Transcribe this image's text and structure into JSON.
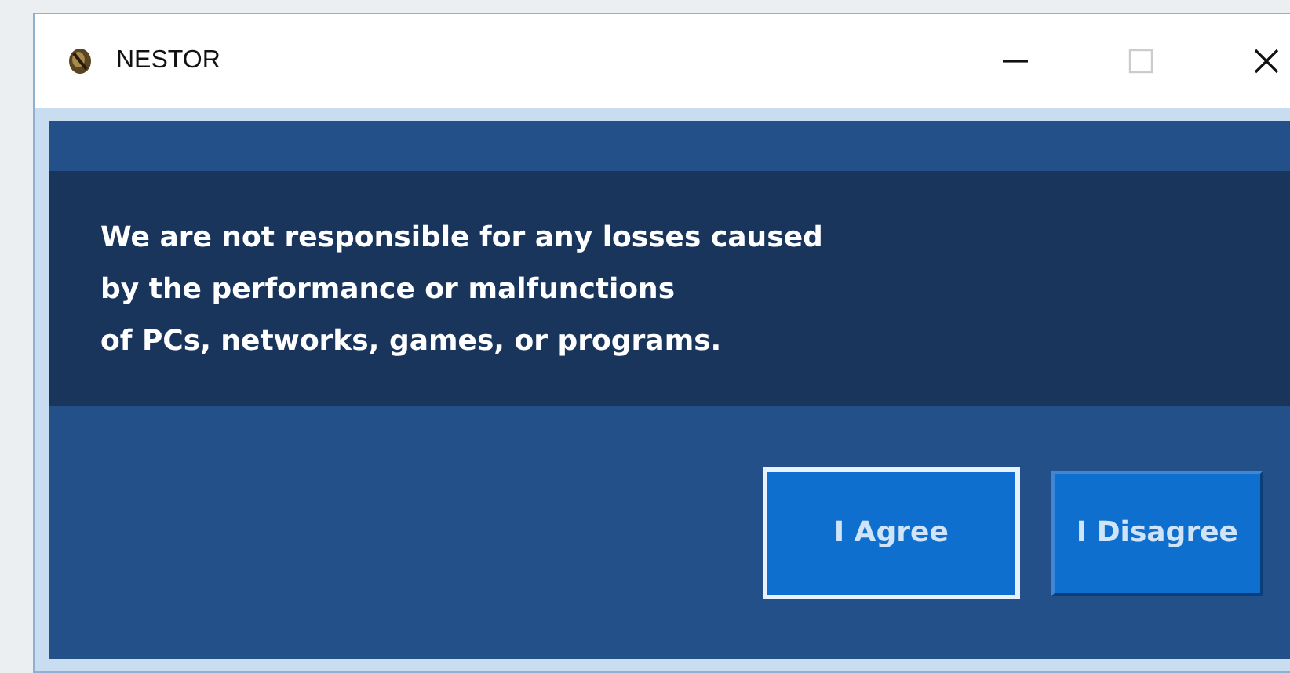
{
  "window": {
    "title": "NESTOR"
  },
  "message": [
    "We are not responsible for any losses caused",
    "by the performance or malfunctions",
    "of PCs, networks, games, or programs."
  ],
  "buttons": [
    {
      "label": "I Agree",
      "focused": true
    },
    {
      "label": "I Disagree",
      "focused": false
    }
  ]
}
